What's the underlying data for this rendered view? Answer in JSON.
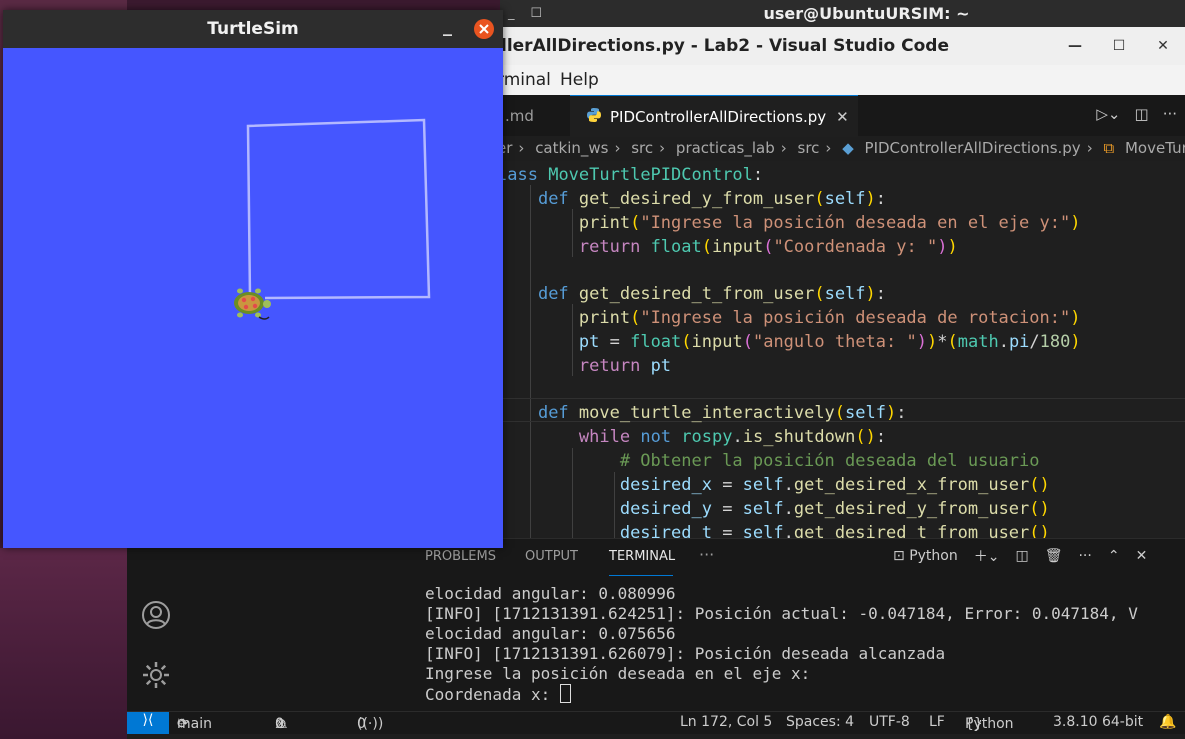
{
  "desktop": {
    "terminal_title": "user@UbuntuURSIM: ~"
  },
  "vscode": {
    "window_title": "llerAllDirections.py - Lab2 - Visual Studio Code",
    "menu": [
      "rminal",
      "Help"
    ],
    "tabs": [
      {
        "label": ".md",
        "active": false
      },
      {
        "label": "PIDControllerAllDirections.py",
        "active": true
      }
    ],
    "breadcrumb": [
      "er",
      "catkin_ws",
      "src",
      "practicas_lab",
      "src",
      "PIDControllerAllDirections.py",
      "MoveTurt"
    ],
    "panel_tabs": [
      "PROBLEMS",
      "OUTPUT",
      "TERMINAL"
    ],
    "panel_active": "TERMINAL",
    "terminal_shell": "Python",
    "terminal_lines": [
      "elocidad angular: 0.080996",
      "[INFO] [1712131391.624251]: Posición actual: -0.047184, Error: 0.047184, V",
      "elocidad angular: 0.075656",
      "[INFO] [1712131391.626079]: Posición deseada alcanzada",
      "Ingrese la posición deseada en el eje x:",
      "Coordenada x: "
    ],
    "status": {
      "branch": "main",
      "errors": "0",
      "warnings": "0",
      "ports": "0",
      "position": "Ln 172, Col 5",
      "spaces": "Spaces: 4",
      "encoding": "UTF-8",
      "eol": "LF",
      "language": "Python",
      "interpreter": "3.8.10 64-bit"
    },
    "accent": "#0078d4"
  },
  "turtlesim": {
    "title": "TurtleSim",
    "background": "#4556ff"
  }
}
